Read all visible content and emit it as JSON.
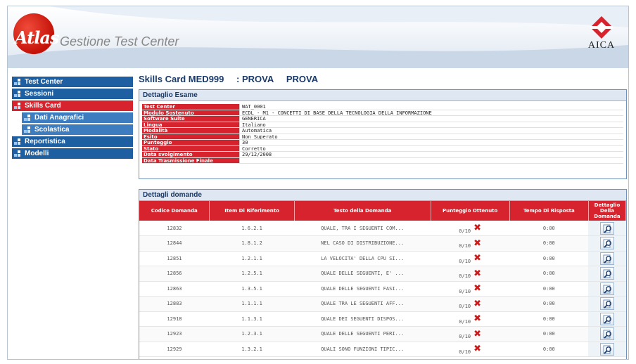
{
  "header": {
    "logo_word": "Atlas",
    "app_title": "Gestione Test Center",
    "partner_logo": "AICA",
    "colors": {
      "brand_red": "#d7232d",
      "nav_blue": "#1d5fa0",
      "panel_border": "#6f93ba"
    }
  },
  "sidebar": {
    "items": [
      {
        "label": "Test Center",
        "icon": "nav-squares-icon",
        "active": false,
        "sub": false
      },
      {
        "label": "Sessioni",
        "icon": "nav-squares-icon",
        "active": false,
        "sub": false
      },
      {
        "label": "Skills Card",
        "icon": "nav-squares-icon",
        "active": true,
        "sub": false
      },
      {
        "label": "Dati Anagrafici",
        "icon": "nav-squares-icon",
        "active": false,
        "sub": true
      },
      {
        "label": "Scolastica",
        "icon": "nav-squares-icon",
        "active": false,
        "sub": true
      },
      {
        "label": "Reportistica",
        "icon": "nav-squares-icon",
        "active": false,
        "sub": false
      },
      {
        "label": "Modelli",
        "icon": "nav-squares-icon",
        "active": false,
        "sub": false
      }
    ]
  },
  "card": {
    "id_label": "Skills Card MED999",
    "name_prefix": ": PROVA",
    "name_suffix": "PROVA"
  },
  "exam": {
    "title": "Dettaglio Esame",
    "rows": [
      {
        "key": "Test Center",
        "value": "WAT_0001"
      },
      {
        "key": "Modulo Sostenuto",
        "value": "ECDL - M1 - CONCETTI DI BASE DELLA TECNOLOGIA DELLA INFORMAZIONE"
      },
      {
        "key": "Software Suite",
        "value": "GENERICA"
      },
      {
        "key": "Lingua",
        "value": "Italiano"
      },
      {
        "key": "Modalità",
        "value": "Automatica"
      },
      {
        "key": "Esito",
        "value": "Non Superato"
      },
      {
        "key": "Punteggio",
        "value": "30"
      },
      {
        "key": "Stato",
        "value": "Corretto"
      },
      {
        "key": "Data svolgimento",
        "value": "29/12/2008"
      },
      {
        "key": "Data Trasmissione Finale",
        "value": ""
      }
    ]
  },
  "questions": {
    "title": "Dettagli domande",
    "columns": [
      "Codice Domanda",
      "Item Di Riferimento",
      "Testo della Domanda",
      "Punteggio Ottenuto",
      "Tempo Di Risposta",
      "Dettaglio Della Domanda"
    ],
    "rows": [
      {
        "code": "12832",
        "item": "1.6.2.1",
        "text": "QUALE, TRA I SEGUENTI COM...",
        "score": "0/10",
        "time": "0:00"
      },
      {
        "code": "12844",
        "item": "1.8.1.2",
        "text": "NEL CASO DI DISTRIBUZIONE...",
        "score": "0/10",
        "time": "0:00"
      },
      {
        "code": "12851",
        "item": "1.2.1.1",
        "text": "LA VELOCITA' DELLA CPU SI...",
        "score": "0/10",
        "time": "0:00"
      },
      {
        "code": "12856",
        "item": "1.2.5.1",
        "text": "QUALE DELLE SEGUENTI, E' ...",
        "score": "0/10",
        "time": "0:00"
      },
      {
        "code": "12863",
        "item": "1.3.5.1",
        "text": "QUALE DELLE SEGUENTI FASI...",
        "score": "0/10",
        "time": "0:00"
      },
      {
        "code": "12883",
        "item": "1.1.1.1",
        "text": "QUALE TRA LE SEGUENTI AFF...",
        "score": "0/10",
        "time": "0:00"
      },
      {
        "code": "12918",
        "item": "1.1.3.1",
        "text": "QUALE DEI SEGUENTI DISPOS...",
        "score": "0/10",
        "time": "0:00"
      },
      {
        "code": "12923",
        "item": "1.2.3.1",
        "text": "QUALE DELLE SEGUENTI PERI...",
        "score": "0/10",
        "time": "0:00"
      },
      {
        "code": "12929",
        "item": "1.3.2.1",
        "text": "QUALI SONO FUNZIONI TIPIC...",
        "score": "0/10",
        "time": "0:00"
      }
    ],
    "wrong_icon": "x-mark-icon",
    "detail_icon": "magnifier-icon"
  }
}
